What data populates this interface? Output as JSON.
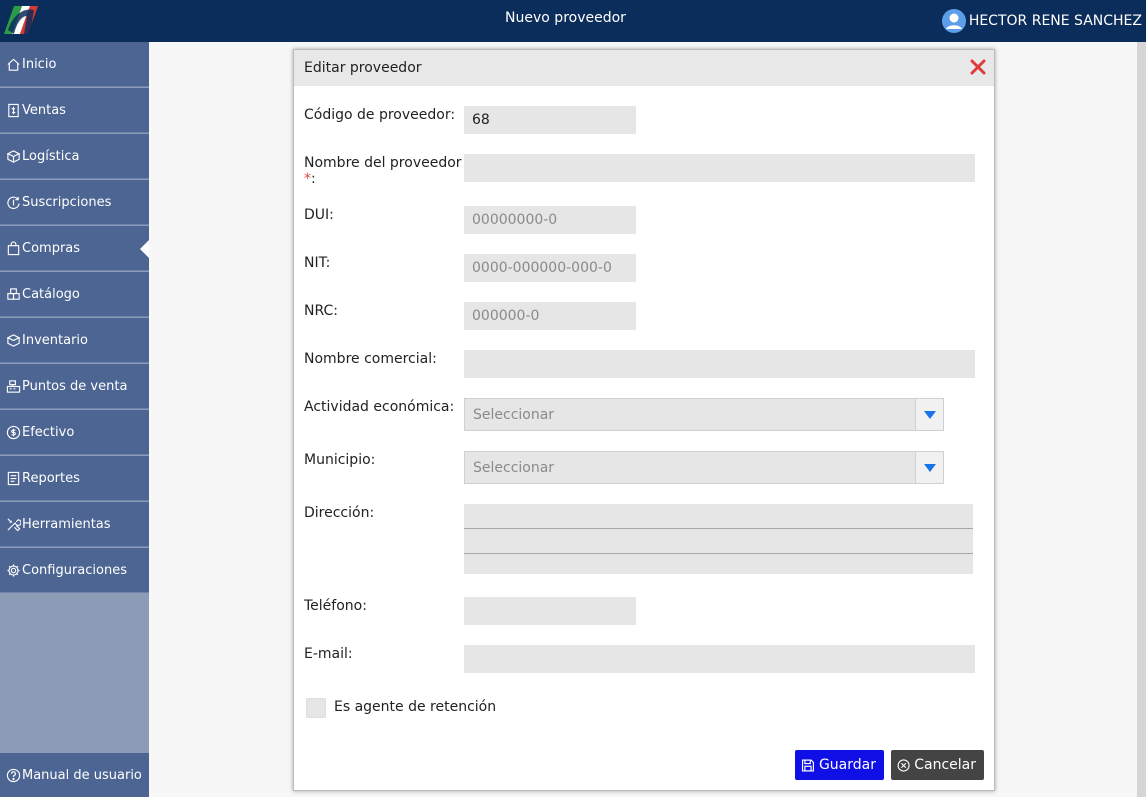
{
  "header": {
    "title": "Nuevo proveedor",
    "user_name": "HECTOR RENE SANCHEZ",
    "logo_icon": "brand-logo",
    "colors": {
      "bar": "#0b2d5b"
    }
  },
  "sidebar": {
    "items": [
      {
        "label": "Inicio",
        "icon": "home-icon"
      },
      {
        "label": "Ventas",
        "icon": "receipt-icon"
      },
      {
        "label": "Logística",
        "icon": "box-icon"
      },
      {
        "label": "Suscripciones",
        "icon": "refresh-dollar-icon"
      },
      {
        "label": "Compras",
        "icon": "shopping-bag-icon",
        "active": true
      },
      {
        "label": "Catálogo",
        "icon": "boxes-icon"
      },
      {
        "label": "Inventario",
        "icon": "inventory-icon"
      },
      {
        "label": "Puntos de venta",
        "icon": "cash-register-icon"
      },
      {
        "label": "Efectivo",
        "icon": "dollar-circle-icon"
      },
      {
        "label": "Reportes",
        "icon": "report-icon"
      },
      {
        "label": "Herramientas",
        "icon": "tools-icon"
      },
      {
        "label": "Configuraciones",
        "icon": "gear-icon"
      }
    ],
    "manual_label": "Manual de usuario",
    "colors": {
      "item": "#4d6592",
      "background": "#8c9bb6"
    }
  },
  "modal": {
    "title": "Editar proveedor",
    "fields": {
      "codigo": {
        "label": "Código de proveedor:",
        "value": "68"
      },
      "nombre": {
        "label": "Nombre del proveedor",
        "required_mark": "*",
        "suffix": ":",
        "value": ""
      },
      "dui": {
        "label": "DUI:",
        "placeholder": "00000000-0"
      },
      "nit": {
        "label": "NIT:",
        "placeholder": "0000-000000-000-0"
      },
      "nrc": {
        "label": "NRC:",
        "placeholder": "000000-0"
      },
      "nombre_comercial": {
        "label": "Nombre comercial:",
        "value": ""
      },
      "actividad": {
        "label": "Actividad económica:",
        "selected": "Seleccionar"
      },
      "municipio": {
        "label": "Municipio:",
        "selected": "Seleccionar"
      },
      "direccion": {
        "label": "Dirección:",
        "value": ""
      },
      "telefono": {
        "label": "Teléfono:",
        "value": ""
      },
      "email": {
        "label": "E-mail:",
        "value": ""
      }
    },
    "checkbox": {
      "label": "Es agente de retención",
      "checked": false
    },
    "buttons": {
      "save": "Guardar",
      "cancel": "Cancelar"
    },
    "colors": {
      "save": "#1010e6",
      "cancel": "#444444",
      "close": "#e03a3a",
      "dropdown_arrow": "#1a73e8"
    }
  }
}
